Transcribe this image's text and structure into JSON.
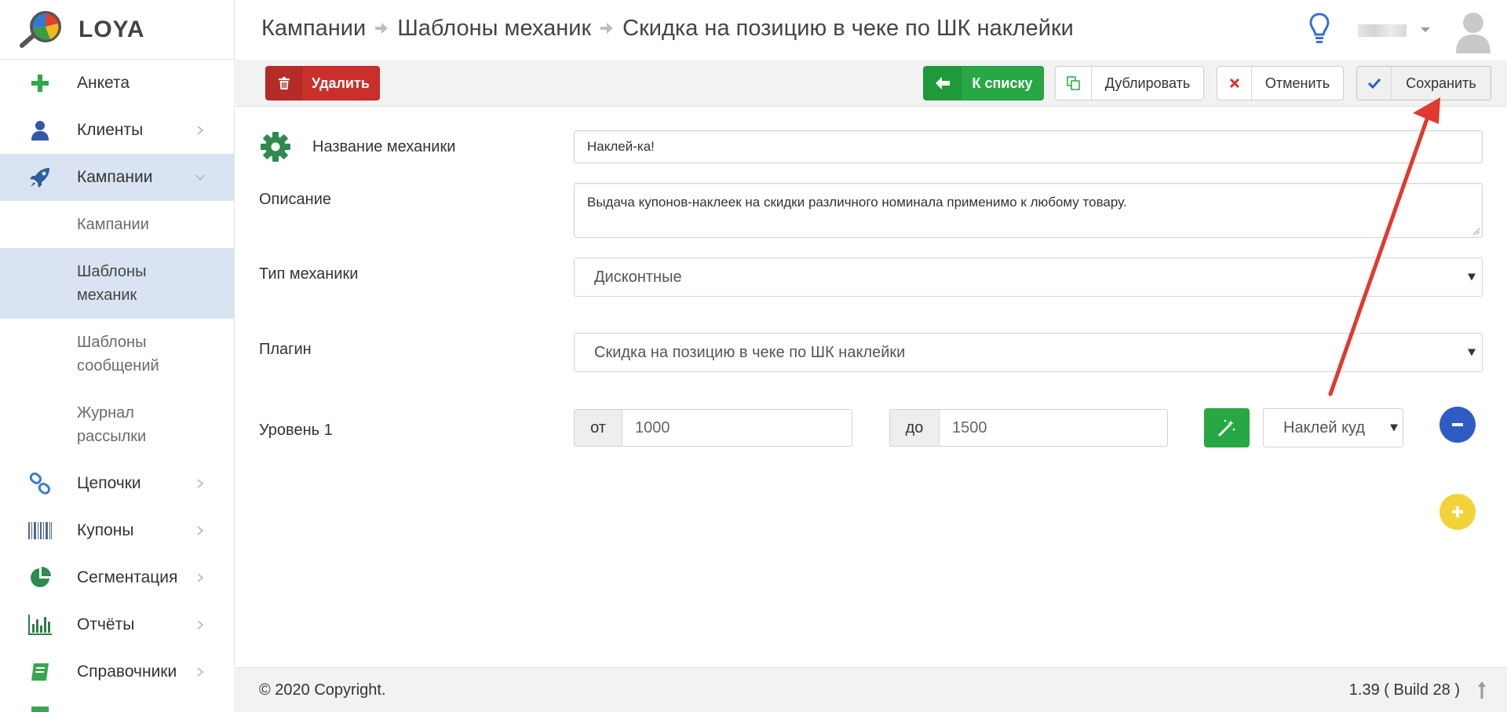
{
  "app": {
    "logo_text": "LOYA"
  },
  "sidebar": {
    "items": [
      {
        "label": "Анкета",
        "icon": "plus-icon",
        "color": "#2ea84a"
      },
      {
        "label": "Клиенты",
        "icon": "user-icon",
        "color": "#3358a8"
      },
      {
        "label": "Кампании",
        "icon": "rocket-icon",
        "color": "#2b5f9e"
      },
      {
        "label": "Цепочки",
        "icon": "link-icon",
        "color": "#3a7fc4"
      },
      {
        "label": "Купоны",
        "icon": "barcode-icon",
        "color": "#4f6b8c"
      },
      {
        "label": "Сегментация",
        "icon": "pie-chart-icon",
        "color": "#2f8a4e"
      },
      {
        "label": "Отчёты",
        "icon": "bar-chart-icon",
        "color": "#2e7d46"
      },
      {
        "label": "Справочники",
        "icon": "book-icon",
        "color": "#3aa64d"
      }
    ],
    "sub_items": [
      {
        "line1": "Кампании",
        "line2": ""
      },
      {
        "line1": "Шаблоны",
        "line2": "механик"
      },
      {
        "line1": "Шаблоны",
        "line2": "сообщений"
      },
      {
        "line1": "Журнал",
        "line2": "рассылки"
      }
    ]
  },
  "header": {
    "breadcrumb": [
      "Кампании",
      "Шаблоны механик",
      "Скидка на позицию в чеке по ШК наклейки"
    ]
  },
  "toolbar": {
    "delete_label": "Удалить",
    "back_label": "К списку",
    "duplicate_label": "Дублировать",
    "cancel_label": "Отменить",
    "save_label": "Сохранить"
  },
  "form": {
    "name_label": "Название механики",
    "name_value": "Наклей-ка!",
    "description_label": "Описание",
    "description_value": "Выдача купонов-наклеек на скидки различного номинала применимо к любому товару.",
    "type_label": "Тип механики",
    "type_value": "Дисконтные",
    "plugin_label": "Плагин",
    "plugin_value": "Скидка на позицию в чеке по ШК наклейки",
    "level_label": "Уровень 1",
    "from_label": "от",
    "from_value": "1000",
    "to_label": "до",
    "to_value": "1500",
    "coupon_select": "Наклей куд"
  },
  "footer": {
    "copyright": "© 2020 Copyright.",
    "version": "1.39 ( Build 28 )"
  },
  "colors": {
    "danger": "#c9302c",
    "success": "#27a844",
    "primary": "#2f5cc4",
    "warning": "#f2d43a",
    "annotation": "#e03a2f"
  }
}
